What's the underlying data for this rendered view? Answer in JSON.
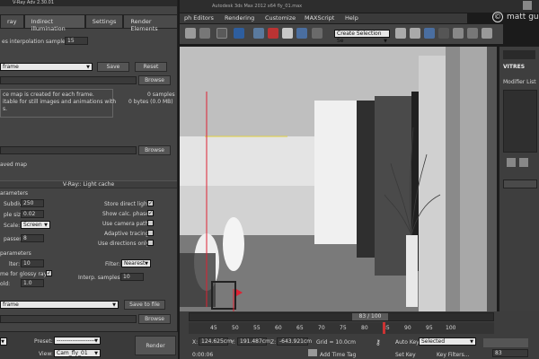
{
  "vray": {
    "title": "V-Ray Adv 2.30.01",
    "tabs": [
      "ray",
      "Indirect illumination",
      "Settings",
      "Render Elements"
    ],
    "interp_label": "es interpolation samples:",
    "interp_value": "15",
    "mode_select": "frame",
    "save_label": "Save",
    "reset_label": "Reset",
    "browse_label": "Browse",
    "desc_line1": "ce map is created for each frame.",
    "desc_line2": "itable for still images and animations with",
    "desc_line3": "s.",
    "samples_text": "0 samples",
    "bytes_text": "0 bytes (0.0 MB)",
    "file_browse_label": "Browse",
    "switch_label": "aved map",
    "lc_section": "V-Ray:: Light cache",
    "params_heading": "arameters",
    "subdivs_label": "Subdivs:",
    "subdivs_value": "250",
    "sample_size_label": "ple size:",
    "sample_size_value": "0.02",
    "scale_label": "Scale:",
    "scale_value": "Screen",
    "passes_label": "passes:",
    "passes_value": "8",
    "store_direct": "Store direct light",
    "show_calc": "Show calc. phase",
    "use_camera_path": "Use camera path",
    "adaptive_tracing": "Adaptive tracing",
    "use_directions_only": "Use directions only",
    "reconstruction_heading": "parameters",
    "prefilter_label": "lter:",
    "prefilter_value": "10",
    "glossy_label": "me for glossy rays",
    "threshold_label": "old:",
    "threshold_value": "1.0",
    "filter_label": "Filter:",
    "filter_value": "Nearest",
    "interp_samples_label": "Interp. samples:",
    "interp_samples_value": "10",
    "mode2_select": "frame",
    "save_to_file_label": "Save to file",
    "browse2_label": "Browse",
    "preset_label": "Preset:",
    "preset_value": "--------------------",
    "view_label": "View:",
    "view_value": "Cam_fly_01",
    "render_label": "Render"
  },
  "max": {
    "titlebar": "Autodesk 3ds Max 2012 x64      fly_01.max",
    "menus": [
      "ph Editors",
      "Rendering",
      "Customize",
      "MAXScript",
      "Help"
    ],
    "selection_set": "Create Selection Se",
    "watermark": "matt gu",
    "cmd_label": "VITRES",
    "modifier_list": "Modifier List",
    "frame_counter": "83 / 100",
    "ticks": [
      "45",
      "50",
      "55",
      "60",
      "65",
      "70",
      "75",
      "80",
      "85",
      "90",
      "95",
      "100"
    ],
    "x_label": "X:",
    "x_value": "124.625cm",
    "y_label": "Y:",
    "y_value": "191.487cm",
    "z_label": "Z:",
    "z_value": "-643.921cm",
    "grid_text": "Grid = 10.0cm",
    "time_text": "0:00:06",
    "add_time_tag": "Add Time Tag",
    "auto_key": "Auto Key",
    "selected_value": "Selected",
    "set_key": "Set Key",
    "key_filters": "Key Filters...",
    "frame_value": "83"
  },
  "colors": {
    "vray_bg": "#444444",
    "viewport_bg": "#b9b9b9",
    "timeline_bg": "#3d3d3d",
    "accent_blue": "#3a6ea5"
  }
}
